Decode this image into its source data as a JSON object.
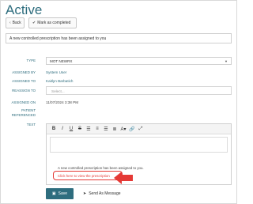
{
  "page": {
    "title": "Active"
  },
  "actions": {
    "back_label": "Back",
    "mark_completed_label": "Mark as completed"
  },
  "subject": {
    "value": "A new controlled prescription has been assigned to you"
  },
  "form": {
    "type_label": "TYPE",
    "type_value": "MOT NEWRX",
    "assigned_by_label": "ASSIGNED BY",
    "assigned_by_value": "System User",
    "assigned_to_label": "ASSIGNED TO",
    "assigned_to_value": "Kaitlyn Barbatich",
    "reassign_label": "REASSIGN TO",
    "reassign_placeholder": "Select...",
    "assigned_on_label": "ASSIGNED ON",
    "assigned_on_value": "11/07/2024 3:38 PM",
    "patient_label_1": "PATIENT",
    "patient_label_2": "REFERENCED",
    "text_label": "TEXT"
  },
  "editor": {
    "toolbar": [
      "B",
      "I",
      "U",
      "S",
      "align-left-icon",
      "align-center-icon",
      "align-right-icon",
      "justify-icon",
      "font-color-icon",
      "link-icon",
      "fullscreen-icon"
    ],
    "message": "A new controlled prescription has been assigned to you.",
    "link_text": "Click here to view the prescription"
  },
  "footer": {
    "save_label": "Save",
    "send_message_label": "Send As Message"
  },
  "colors": {
    "accent": "#2e6d7e",
    "highlight": "#e53935"
  }
}
